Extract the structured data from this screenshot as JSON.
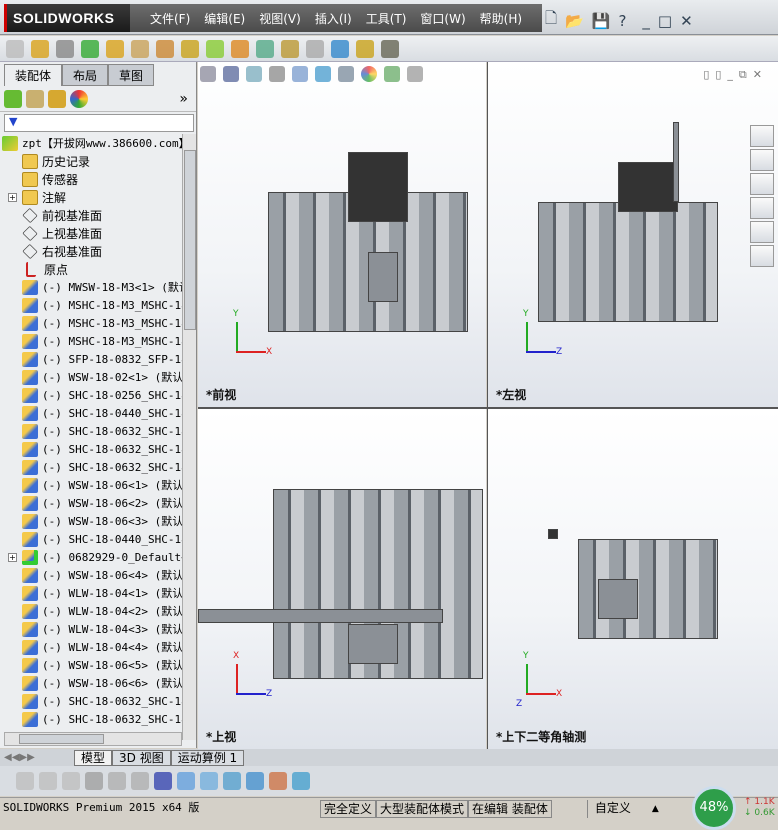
{
  "app": {
    "logo": "SOLIDWORKS",
    "menu": [
      "文件(F)",
      "编辑(E)",
      "视图(V)",
      "插入(I)",
      "工具(T)",
      "窗口(W)",
      "帮助(H)"
    ]
  },
  "left_panel": {
    "tabs": [
      "装配体",
      "布局",
      "草图"
    ],
    "more": "»",
    "filter_icon": "funnel-icon",
    "tree": [
      {
        "label": "zpt【开拔网www.386600.com】",
        "icon": "assembly",
        "root": true
      },
      {
        "label": "历史记录",
        "icon": "folder"
      },
      {
        "label": "传感器",
        "icon": "folder"
      },
      {
        "label": "注解",
        "icon": "folder",
        "expandable": true
      },
      {
        "label": "前视基准面",
        "icon": "plane"
      },
      {
        "label": "上视基准面",
        "icon": "plane"
      },
      {
        "label": "右视基准面",
        "icon": "plane"
      },
      {
        "label": "原点",
        "icon": "origin"
      },
      {
        "label": "(-) MWSW-18-M3<1> (默认",
        "icon": "part"
      },
      {
        "label": "(-) MSHC-18-M3_MSHC-18-",
        "icon": "part"
      },
      {
        "label": "(-) MSHC-18-M3_MSHC-18-",
        "icon": "part"
      },
      {
        "label": "(-) MSHC-18-M3_MSHC-18-",
        "icon": "part"
      },
      {
        "label": "(-) SFP-18-0832_SFP-18-",
        "icon": "part"
      },
      {
        "label": "(-) WSW-18-02<1> (默认)",
        "icon": "part"
      },
      {
        "label": "(-) SHC-18-0256_SHC-18-",
        "icon": "part"
      },
      {
        "label": "(-) SHC-18-0440_SHC-18-",
        "icon": "part"
      },
      {
        "label": "(-) SHC-18-0632_SHC-18-",
        "icon": "part"
      },
      {
        "label": "(-) SHC-18-0632_SHC-18-",
        "icon": "part"
      },
      {
        "label": "(-) SHC-18-0632_SHC-18-",
        "icon": "part"
      },
      {
        "label": "(-) WSW-18-06<1> (默认)",
        "icon": "part"
      },
      {
        "label": "(-) WSW-18-06<2> (默认)",
        "icon": "part"
      },
      {
        "label": "(-) WSW-18-06<3> (默认)",
        "icon": "part"
      },
      {
        "label": "(-) SHC-18-0440_SHC-18-",
        "icon": "part"
      },
      {
        "label": "(-) 0682929-0_Default<1",
        "icon": "subassembly",
        "expandable": true
      },
      {
        "label": "(-) WSW-18-06<4> (默认)",
        "icon": "part"
      },
      {
        "label": "(-) WLW-18-04<1> (默认)",
        "icon": "part"
      },
      {
        "label": "(-) WLW-18-04<2> (默认)",
        "icon": "part"
      },
      {
        "label": "(-) WLW-18-04<3> (默认)",
        "icon": "part"
      },
      {
        "label": "(-) WLW-18-04<4> (默认)",
        "icon": "part"
      },
      {
        "label": "(-) WSW-18-06<5> (默认)",
        "icon": "part"
      },
      {
        "label": "(-) WSW-18-06<6> (默认)",
        "icon": "part"
      },
      {
        "label": "(-) SHC-18-0632_SHC-18-",
        "icon": "part"
      },
      {
        "label": "(-) SHC-18-0632_SHC-18-",
        "icon": "part"
      }
    ]
  },
  "viewports": [
    {
      "label": "*前视",
      "axes": [
        "Y",
        "X"
      ]
    },
    {
      "label": "*左视",
      "axes": [
        "Y",
        "Z"
      ]
    },
    {
      "label": "*上视",
      "axes": [
        "X",
        "Z"
      ]
    },
    {
      "label": "*上下二等角轴测",
      "axes": [
        "Y",
        "X",
        "Z"
      ]
    }
  ],
  "bottom_tabs": [
    "模型",
    "3D 视图",
    "运动算例 1"
  ],
  "status": {
    "product": "SOLIDWORKS Premium 2015 x64 版",
    "cells": [
      "完全定义",
      "大型装配体模式",
      "在编辑 装配体"
    ],
    "custom": "自定义",
    "gauge": "48%",
    "net_up": "1.1K",
    "net_down": "0.6K"
  }
}
